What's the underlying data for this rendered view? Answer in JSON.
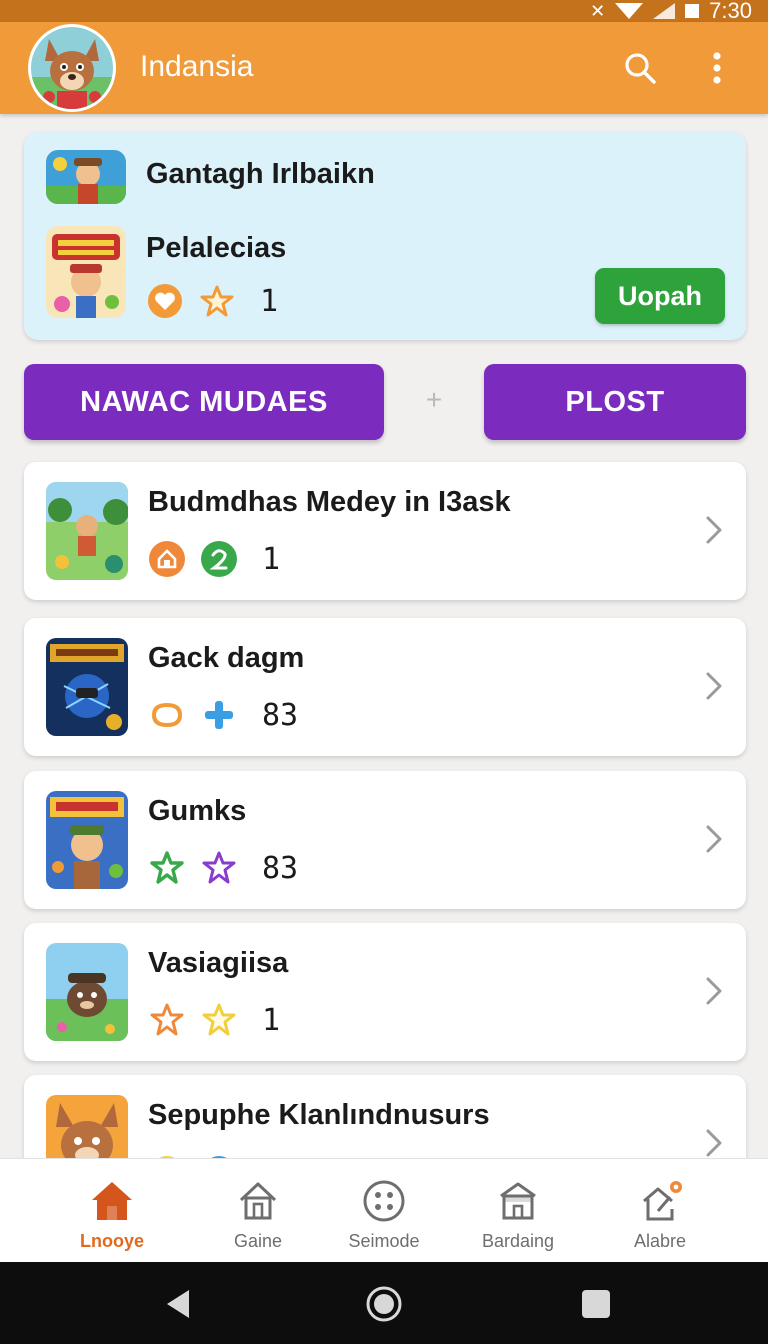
{
  "status_bar": {
    "time": "7:30"
  },
  "app_bar": {
    "title": "Indansia"
  },
  "featured": {
    "item1_title": "Gantagh Irlbaikn",
    "item2_title": "Pelalecias",
    "item2_count": "1",
    "update_label": "Uopah"
  },
  "actions": {
    "left_label": "NAWAC MUDAES",
    "separator": "+",
    "right_label": "PLOST"
  },
  "list": [
    {
      "title": "Budmdhas Medey in I3ask",
      "count": "1"
    },
    {
      "title": "Gack dagm",
      "count": "83"
    },
    {
      "title": "Gumks",
      "count": "83"
    },
    {
      "title": "Vasiagiisa",
      "count": "1"
    },
    {
      "title": "Sepuphe Klanlındnusurs",
      "count": ""
    }
  ],
  "bottom_nav": [
    {
      "label": "Lnooye",
      "icon": "home-icon",
      "active": true
    },
    {
      "label": "Gaine",
      "icon": "house-outline-icon"
    },
    {
      "label": "Seimode",
      "icon": "dots-circle-icon"
    },
    {
      "label": "Bardaing",
      "icon": "store-icon"
    },
    {
      "label": "Alabre",
      "icon": "edit-house-icon"
    }
  ],
  "colors": {
    "app_bar": "#f19a3a",
    "purple": "#7b2cbf",
    "green": "#2ea33c",
    "active_nav": "#e26a1f"
  }
}
